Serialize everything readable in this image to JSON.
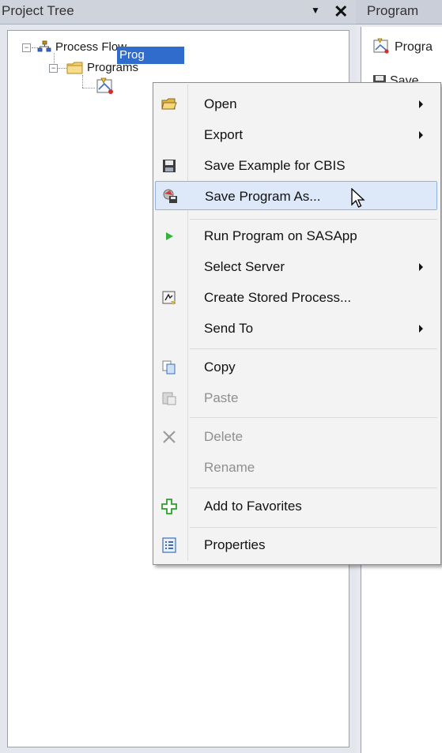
{
  "tree_panel": {
    "title": "Project Tree",
    "pin_icon": "dropdown-arrow-icon",
    "close_icon": "close-icon",
    "nodes": [
      {
        "label": "Process Flow",
        "icon": "process-flow-icon",
        "expander": "−"
      },
      {
        "label": "Programs",
        "icon": "folder-icon",
        "expander": "−"
      },
      {
        "label": "Prog",
        "icon": "sas-program-icon",
        "selected": true
      }
    ]
  },
  "right_panel": {
    "title": "Program",
    "items": [
      {
        "label": "Progra",
        "icon": "sas-program-icon"
      },
      {
        "label": "Save",
        "icon": "save-icon"
      }
    ]
  },
  "context_menu": {
    "items": [
      {
        "label": "Open",
        "icon": "open-folder-icon",
        "submenu": true,
        "disabled": false
      },
      {
        "label": "Export",
        "icon": "",
        "submenu": true,
        "disabled": false
      },
      {
        "label": "Save Example for CBIS",
        "icon": "save-icon",
        "submenu": false,
        "disabled": false
      },
      {
        "label": "Save Program As...",
        "icon": "save-as-icon",
        "submenu": false,
        "disabled": false,
        "highlighted": true
      },
      {
        "label": "Run Program on SASApp",
        "icon": "run-icon",
        "submenu": false,
        "disabled": false
      },
      {
        "label": "Select Server",
        "icon": "",
        "submenu": true,
        "disabled": false
      },
      {
        "label": "Create Stored Process...",
        "icon": "stored-process-icon",
        "submenu": false,
        "disabled": false
      },
      {
        "label": "Send To",
        "icon": "",
        "submenu": true,
        "disabled": false
      },
      {
        "label": "Copy",
        "icon": "copy-icon",
        "submenu": false,
        "disabled": false
      },
      {
        "label": "Paste",
        "icon": "paste-icon",
        "submenu": false,
        "disabled": true
      },
      {
        "label": "Delete",
        "icon": "delete-icon",
        "submenu": false,
        "disabled": true
      },
      {
        "label": "Rename",
        "icon": "",
        "submenu": false,
        "disabled": true
      },
      {
        "label": "Add to Favorites",
        "icon": "add-favorite-icon",
        "submenu": false,
        "disabled": false
      },
      {
        "label": "Properties",
        "icon": "properties-icon",
        "submenu": false,
        "disabled": false
      }
    ]
  },
  "colors": {
    "selection": "#2f6ccc",
    "menu_highlight": "#dde9f8",
    "menu_highlight_border": "#8fb3e0",
    "add_icon_green": "#2aa02a"
  }
}
